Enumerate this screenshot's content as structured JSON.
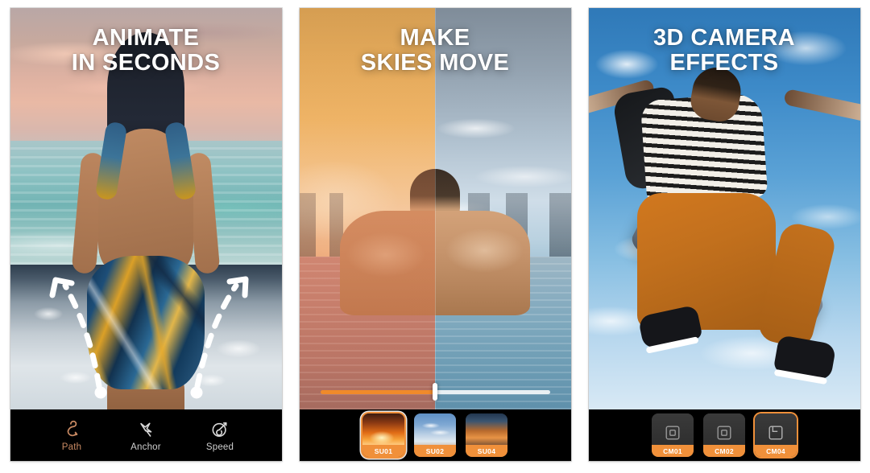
{
  "gallery": {
    "panels": [
      {
        "id": "animate-in-seconds",
        "headline_line1": "ANIMATE",
        "headline_line2": "IN SECONDS",
        "toolbar": {
          "type": "tools",
          "items": [
            {
              "label": "Path",
              "icon": "path-arrow-icon",
              "active": true
            },
            {
              "label": "Anchor",
              "icon": "anchor-pin-icon",
              "active": false
            },
            {
              "label": "Speed",
              "icon": "speedometer-icon",
              "active": false
            }
          ]
        }
      },
      {
        "id": "make-skies-move",
        "headline_line1": "MAKE",
        "headline_line2": "SKIES MOVE",
        "slider": {
          "value_percent": 50
        },
        "toolbar": {
          "type": "thumbnails",
          "items": [
            {
              "label": "SU01",
              "selected": true
            },
            {
              "label": "SU02",
              "selected": false
            },
            {
              "label": "SU04",
              "selected": false
            }
          ]
        }
      },
      {
        "id": "3d-camera-effects",
        "headline_line1": "3D CAMERA",
        "headline_line2": "EFFECTS",
        "toolbar": {
          "type": "camera-thumbnails",
          "items": [
            {
              "label": "CM01",
              "icon": "frame-square-icon",
              "selected": false
            },
            {
              "label": "CM02",
              "icon": "frame-square-icon",
              "selected": false
            },
            {
              "label": "CM04",
              "icon": "frame-corner-icon",
              "selected": true
            }
          ]
        }
      }
    ]
  },
  "colors": {
    "accent_orange": "#f0903a",
    "active_tool": "#c98a63",
    "bar_background": "#000000",
    "headline": "#ffffff",
    "page_background": "#ffffff"
  }
}
